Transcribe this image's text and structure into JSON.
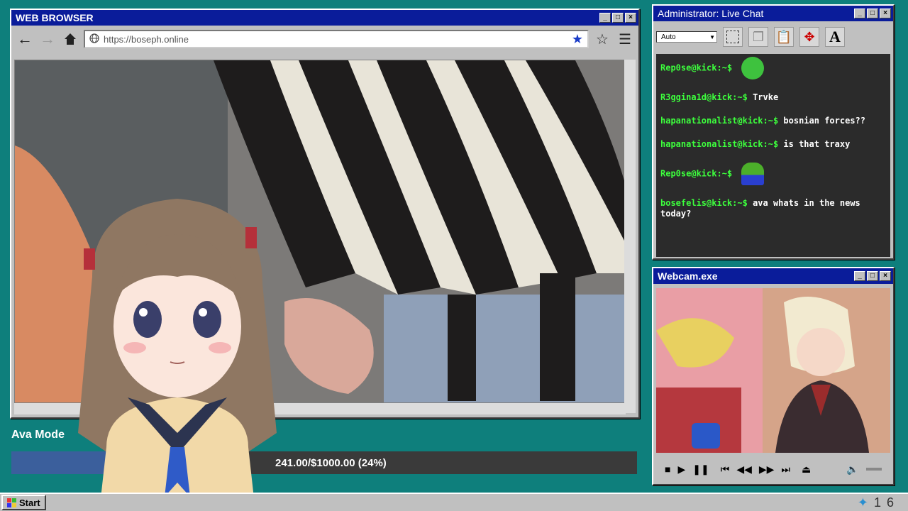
{
  "browser": {
    "title": "WEB BROWSER",
    "url": "https://boseph.online"
  },
  "chat": {
    "title": "Administrator: Live Chat",
    "font_select": "Auto",
    "messages": [
      {
        "user": "Rep0se@kick:~$",
        "text": "",
        "emote": "green-pepe-laugh-icon"
      },
      {
        "user": "R3ggina1d@kick:~$",
        "text": "Trvke"
      },
      {
        "user": "hapanationalist@kick:~$",
        "text": "bosnian forces??"
      },
      {
        "user": "hapanationalist@kick:~$",
        "text": "is that traxy"
      },
      {
        "user": "Rep0se@kick:~$",
        "text": "",
        "emote": "pepe-frog-icon"
      },
      {
        "user": "bosefelis@kick:~$",
        "text": "ava whats in the news today?"
      }
    ]
  },
  "webcam": {
    "title": "Webcam.exe"
  },
  "goal": {
    "label": "Ava Mode",
    "text": "241.00/$1000.00 (24%)",
    "progress": 0.24
  },
  "taskbar": {
    "start_label": "Start",
    "clock": "16"
  },
  "colors": {
    "desktop": "#0e7f7c",
    "titlebar": "#0a1c9a",
    "chat_user": "#3dff3d"
  }
}
